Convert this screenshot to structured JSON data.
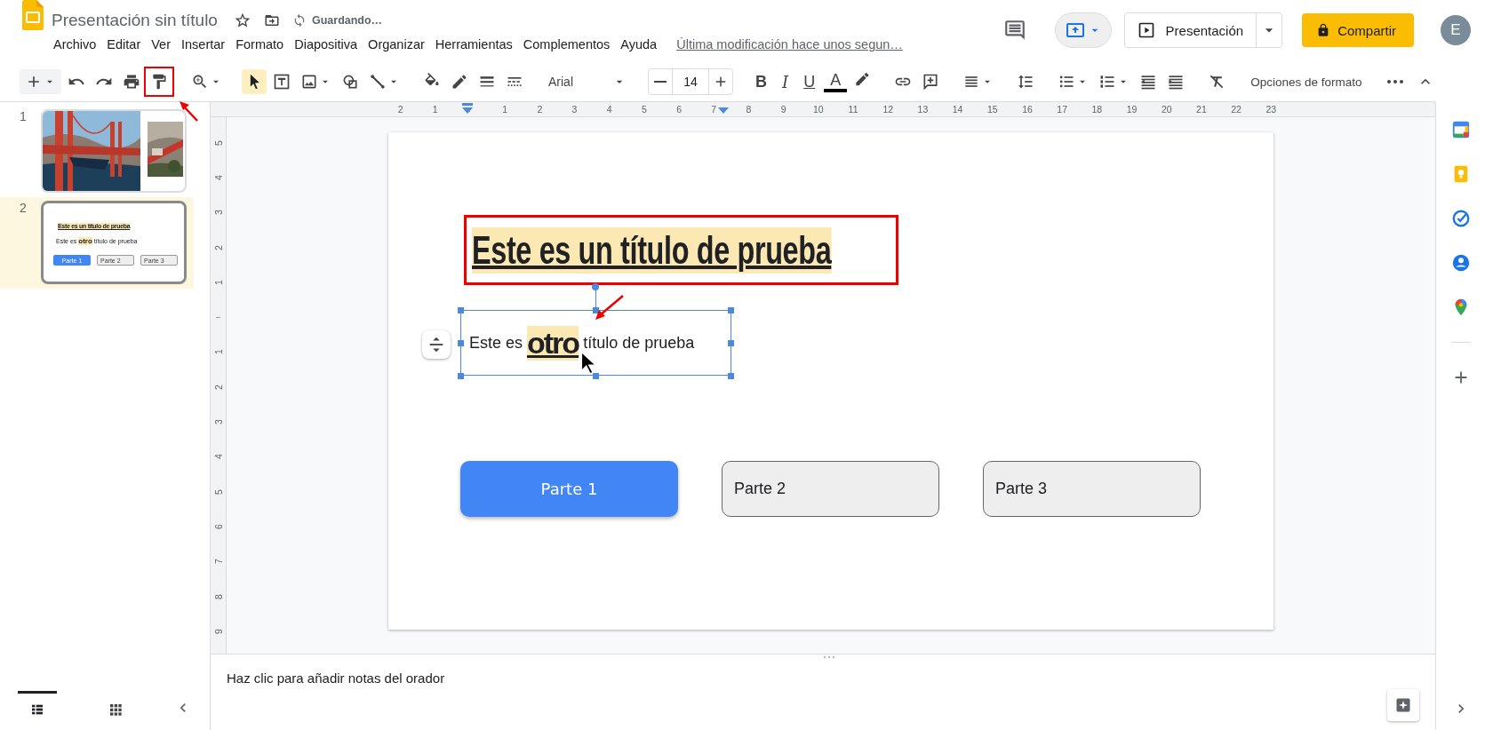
{
  "app": {
    "title": "Presentación sin título",
    "save_status": "Guardando…",
    "last_edit": "Última modificación hace unos segun…"
  },
  "menu": [
    "Archivo",
    "Editar",
    "Ver",
    "Insertar",
    "Formato",
    "Diapositiva",
    "Organizar",
    "Herramientas",
    "Complementos",
    "Ayuda"
  ],
  "header": {
    "present_label": "Presentación",
    "share_label": "Compartir",
    "avatar_initial": "E"
  },
  "toolbar": {
    "select_tool": {
      "selected": true
    },
    "paint_format": {
      "marked": true
    },
    "font": "Arial",
    "font_size": "14",
    "text_styles": [
      "B",
      "I",
      "U",
      "A"
    ],
    "format_options": "Opciones de formato"
  },
  "ruler": {
    "horizontal": [
      {
        "label": "2"
      },
      {
        "label": "1"
      },
      {
        "kind": "origin"
      },
      {
        "label": "1"
      },
      {
        "label": "2"
      },
      {
        "label": "3"
      },
      {
        "label": "4"
      },
      {
        "label": "5"
      },
      {
        "label": "6"
      },
      {
        "label": "7"
      },
      {
        "label": "8"
      },
      {
        "label": "9"
      },
      {
        "label": "10"
      },
      {
        "label": "11"
      },
      {
        "label": "12"
      },
      {
        "label": "13"
      },
      {
        "label": "14"
      },
      {
        "label": "15"
      },
      {
        "label": "16"
      },
      {
        "label": "17"
      },
      {
        "label": "18"
      },
      {
        "label": "19"
      },
      {
        "label": "20"
      },
      {
        "label": "21"
      },
      {
        "label": "22"
      },
      {
        "label": "23"
      }
    ],
    "vertical": [
      {
        "label": "5"
      },
      {
        "label": "4"
      },
      {
        "label": "3"
      },
      {
        "label": "2"
      },
      {
        "label": "1"
      },
      {
        "kind": "origin"
      },
      {
        "label": "1"
      },
      {
        "label": "2"
      },
      {
        "label": "3"
      },
      {
        "label": "4"
      },
      {
        "label": "5"
      },
      {
        "label": "6"
      },
      {
        "label": "7"
      },
      {
        "label": "8"
      },
      {
        "label": "9"
      }
    ]
  },
  "slides": [
    {
      "number": "1",
      "selected": false
    },
    {
      "number": "2",
      "selected": true,
      "kind": "text",
      "title": "Este es un título de prueba",
      "body": [
        {
          "text": "Este es ",
          "kind": "plain"
        },
        {
          "text": "otro",
          "kind": "heavy"
        },
        {
          "text": " título de prueba",
          "kind": "plain"
        }
      ],
      "buttons": [
        {
          "label": "Parte 1",
          "kind": "primary"
        },
        {
          "label": "Parte 2",
          "kind": "secondary"
        },
        {
          "label": "Parte 3",
          "kind": "secondary"
        }
      ]
    }
  ],
  "slide": {
    "title": {
      "text": "Este es un título de prueba",
      "marked": true
    },
    "body": {
      "selected": true,
      "segments": [
        {
          "text": "Este es ",
          "kind": "plain"
        },
        {
          "text": "otro",
          "kind": "heavy"
        },
        {
          "text": " título de prueba",
          "kind": "plain"
        }
      ]
    },
    "buttons": [
      {
        "label": "Parte 1",
        "kind": "primary"
      },
      {
        "label": "Parte 2",
        "kind": "secondary"
      },
      {
        "label": "Parte 3",
        "kind": "secondary"
      }
    ]
  },
  "notes": {
    "placeholder": "Haz clic para añadir notas del orador"
  },
  "view_switcher": [
    {
      "kind": "list",
      "selected": true
    },
    {
      "kind": "grid",
      "selected": false
    }
  ]
}
